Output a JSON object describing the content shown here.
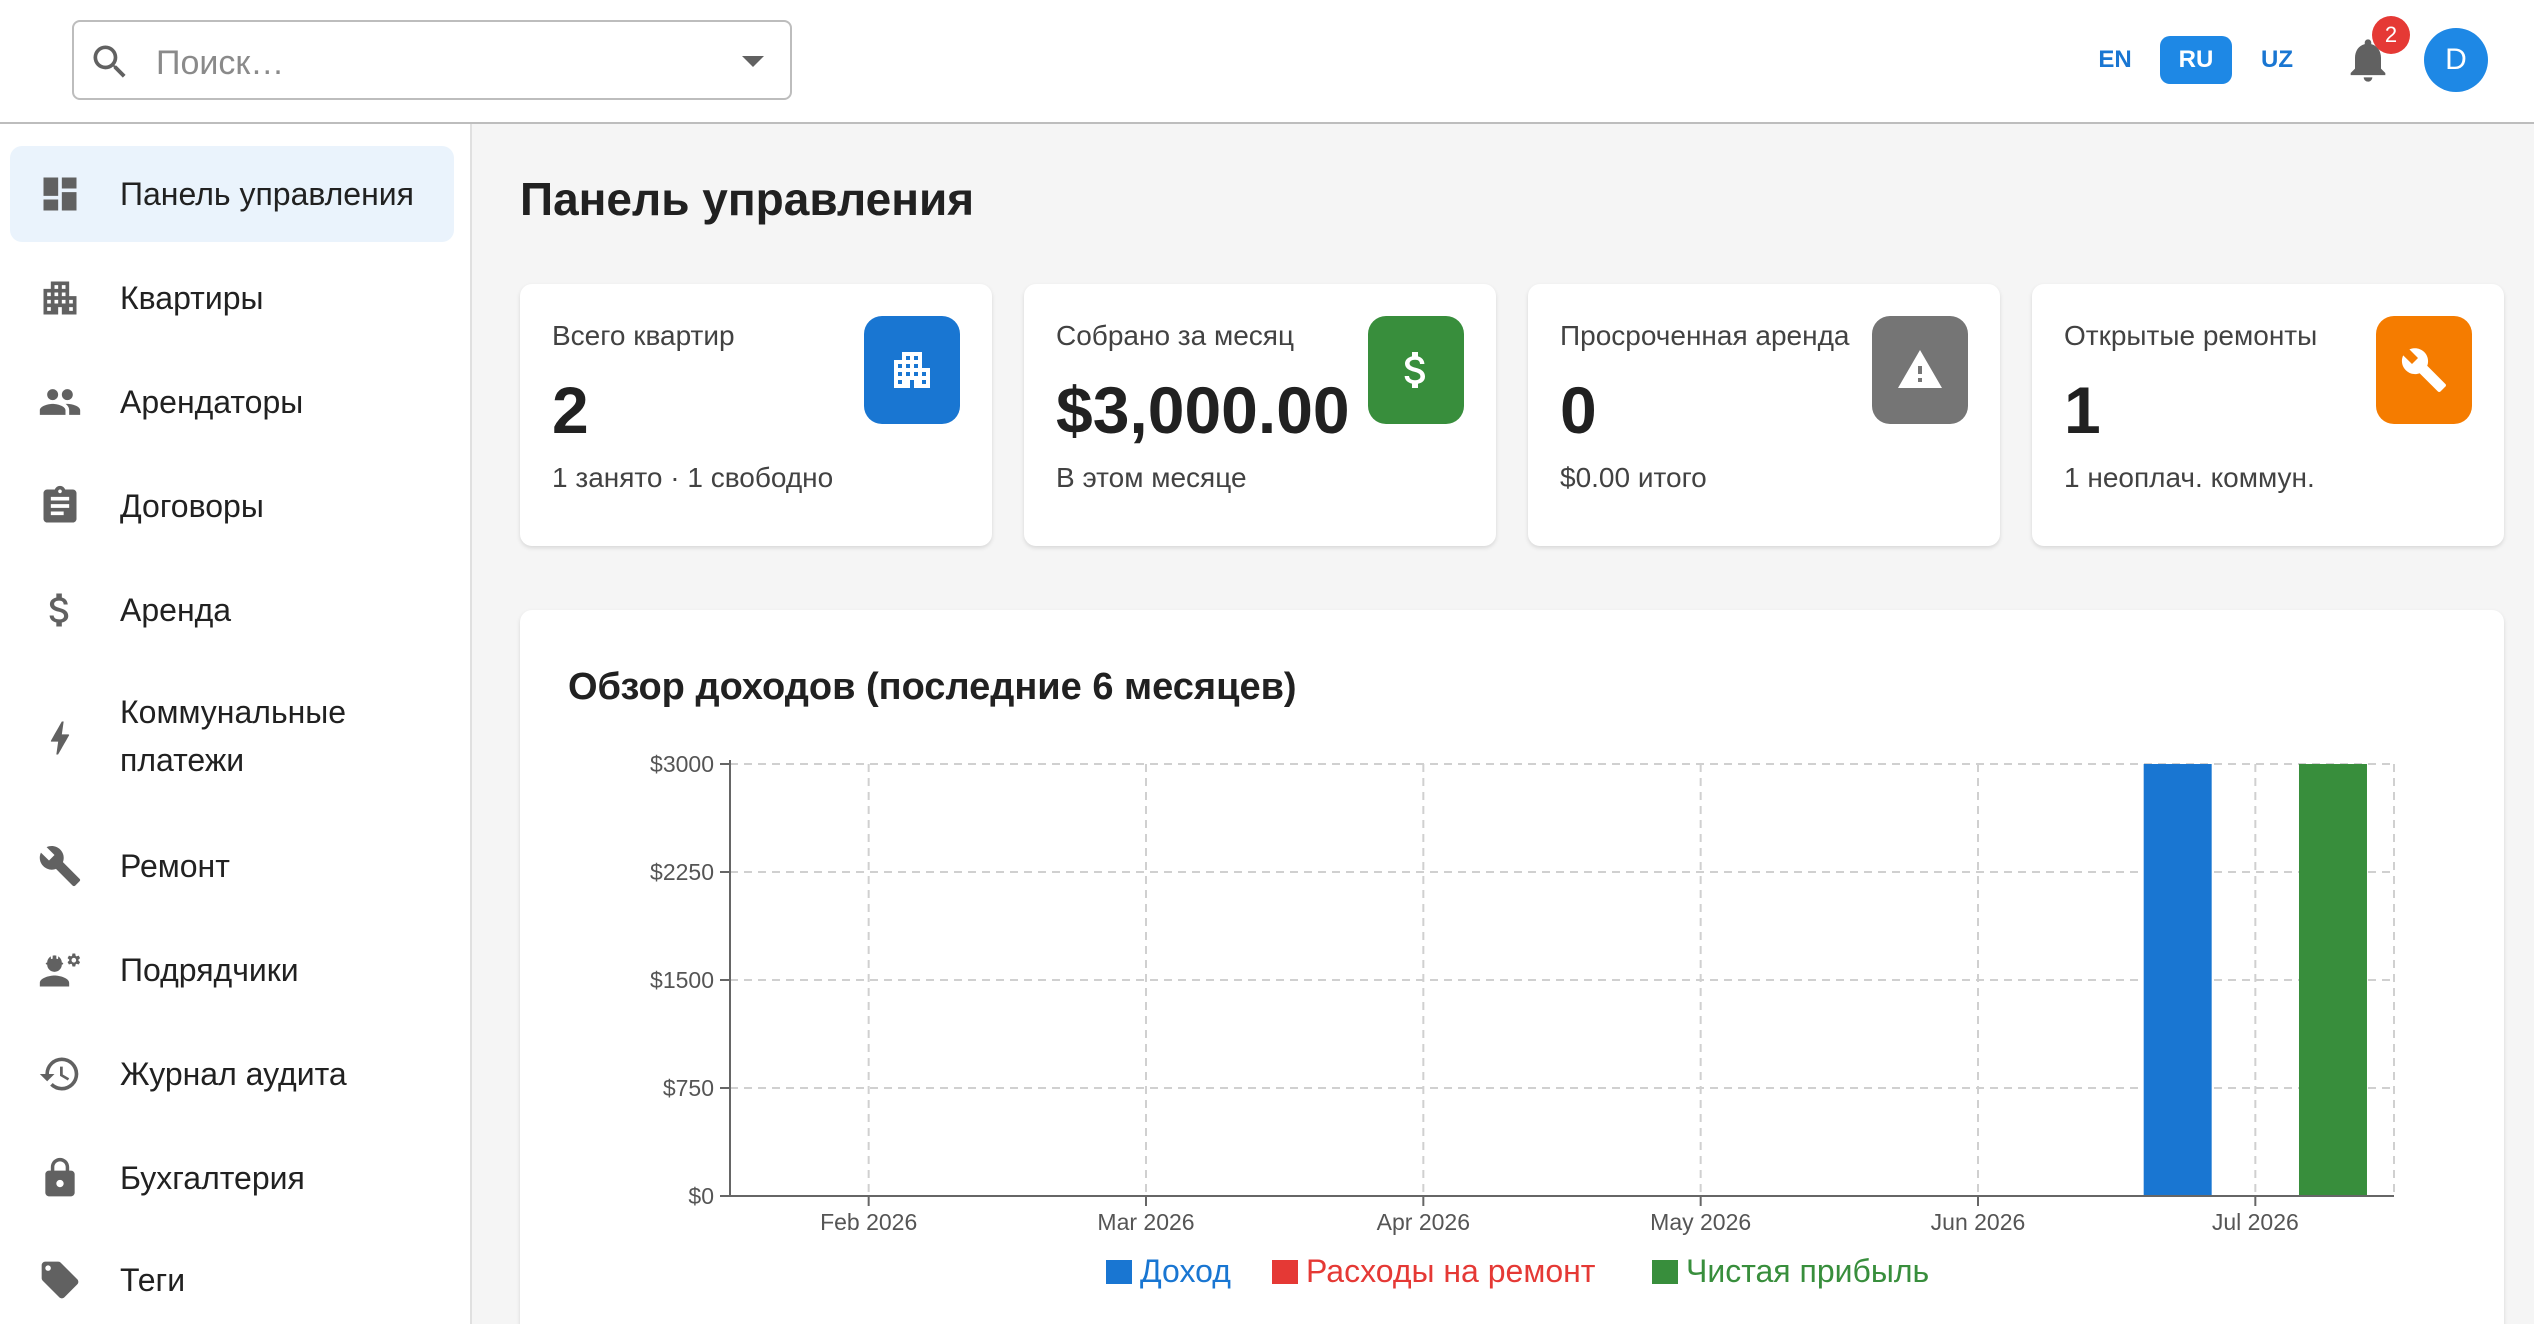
{
  "search": {
    "placeholder": "Поиск…"
  },
  "languages": [
    {
      "code": "EN",
      "active": false
    },
    {
      "code": "RU",
      "active": true
    },
    {
      "code": "UZ",
      "active": false
    }
  ],
  "notifications": {
    "count": "2"
  },
  "user": {
    "initial": "D"
  },
  "sidebar": {
    "items": [
      {
        "label": "Панель управления",
        "icon": "dashboard-icon",
        "active": true
      },
      {
        "label": "Квартиры",
        "icon": "apartment-icon"
      },
      {
        "label": "Арендаторы",
        "icon": "people-icon"
      },
      {
        "label": "Договоры",
        "icon": "clipboard-icon"
      },
      {
        "label": "Аренда",
        "icon": "dollar-icon"
      },
      {
        "label_line1": "Коммунальные",
        "label_line2": "платежи",
        "icon": "bolt-icon"
      },
      {
        "label": "Ремонт",
        "icon": "wrench-icon"
      },
      {
        "label": "Подрядчики",
        "icon": "engineer-icon"
      },
      {
        "label": "Журнал аудита",
        "icon": "history-icon"
      },
      {
        "label": "Бухгалтерия",
        "icon": "lock-icon"
      },
      {
        "label": "Теги",
        "icon": "tag-icon"
      }
    ]
  },
  "page": {
    "title": "Панель управления"
  },
  "cards": [
    {
      "label": "Всего квартир",
      "value": "2",
      "sub": "1 занято · 1 свободно",
      "icon": "apartment-icon",
      "color": "#1976d2"
    },
    {
      "label": "Собрано за месяц",
      "value": "$3,000.00",
      "sub": "В этом месяце",
      "icon": "dollar-icon",
      "color": "#388e3c"
    },
    {
      "label": "Просроченная аренда",
      "value": "0",
      "sub": "$0.00 итого",
      "icon": "warning-icon",
      "color": "#757575"
    },
    {
      "label": "Открытые ремонты",
      "value": "1",
      "sub": "1 неоплач. коммун.",
      "icon": "wrench-icon",
      "color": "#f57c00"
    }
  ],
  "chart_data": {
    "type": "bar",
    "title": "Обзор доходов (последние 6 месяцев)",
    "categories": [
      "Feb 2026",
      "Mar 2026",
      "Apr 2026",
      "May 2026",
      "Jun 2026",
      "Jul 2026"
    ],
    "series": [
      {
        "name": "Доход",
        "values": [
          0,
          0,
          0,
          0,
          0,
          3000
        ],
        "color": "#1976d2"
      },
      {
        "name": "Расходы на ремонт",
        "values": [
          0,
          0,
          0,
          0,
          0,
          0
        ],
        "color": "#e53935"
      },
      {
        "name": "Чистая прибыль",
        "values": [
          0,
          0,
          0,
          0,
          0,
          3000
        ],
        "color": "#388e3c"
      }
    ],
    "yticks": [
      "$0",
      "$750",
      "$1500",
      "$2250",
      "$3000"
    ],
    "ylim": [
      0,
      3000
    ],
    "grid": true,
    "legend": "bottom-center"
  }
}
